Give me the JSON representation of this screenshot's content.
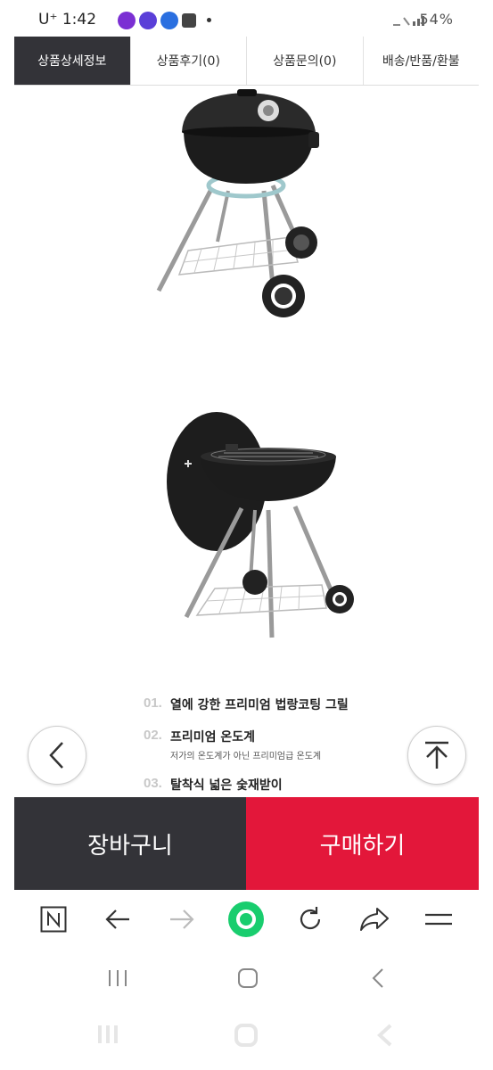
{
  "status_bar": {
    "carrier": "U⁺",
    "time": "1:42",
    "battery": "54%"
  },
  "tabs": [
    {
      "label": "상품상세정보",
      "active": true
    },
    {
      "label": "상품후기(0)",
      "active": false
    },
    {
      "label": "상품문의(0)",
      "active": false
    },
    {
      "label": "배송/반품/환불",
      "active": false
    }
  ],
  "features": [
    {
      "num": "01.",
      "title": "열에 강한 프리미엄 법랑코팅 그릴",
      "sub": ""
    },
    {
      "num": "02.",
      "title": "프리미엄 온도계",
      "sub": "저가의 온도계가 아닌 프리미엄급 온도계"
    },
    {
      "num": "03.",
      "title": "탈착식 넓은 숯재받이",
      "sub": ""
    }
  ],
  "actions": {
    "cart_label": "장바구니",
    "buy_label": "구매하기"
  },
  "toolbar_icons": [
    "naver-icon",
    "back-arrow-icon",
    "forward-arrow-icon",
    "home-icon",
    "refresh-icon",
    "share-icon",
    "menu-icon"
  ],
  "colors": {
    "tab_active": "#333338",
    "cart": "#333338",
    "buy": "#e3173a",
    "home_green": "#19cd6e"
  }
}
